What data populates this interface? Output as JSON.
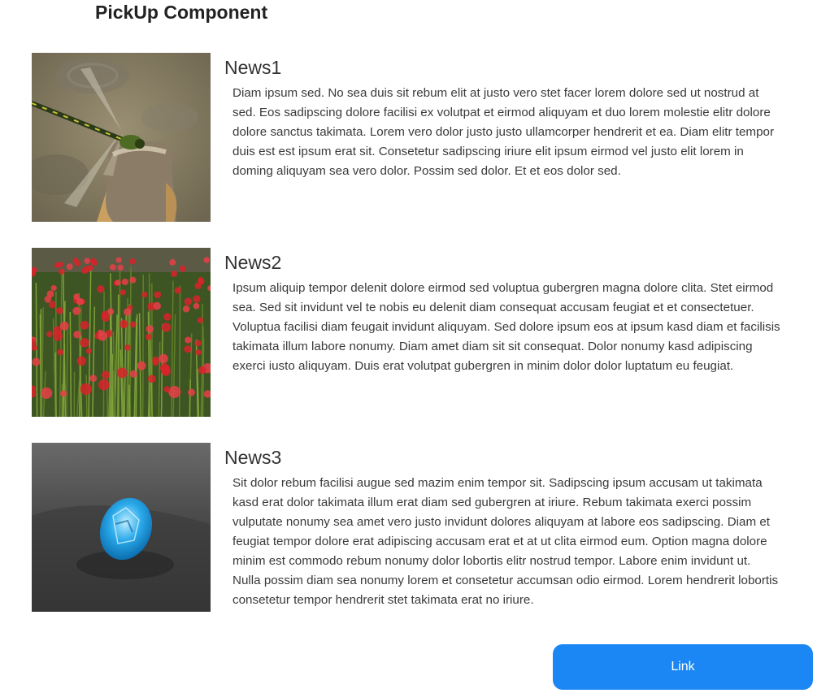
{
  "page": {
    "title": "PickUp Component"
  },
  "news": [
    {
      "title": "News1",
      "image_icon": "dragonfly-photo",
      "body": "Diam ipsum sed. No sea duis sit rebum elit at justo vero stet facer lorem dolore sed ut nostrud at sed. Eos sadipscing dolore facilisi ex volutpat et eirmod aliquyam et duo lorem molestie elitr dolore dolore sanctus takimata. Lorem vero dolor justo justo ullamcorper hendrerit et ea. Diam elitr tempor duis est est ipsum erat sit. Consetetur sadipscing iriure elit ipsum eirmod vel justo elit lorem in doming aliquyam sea vero dolor. Possim sed dolor. Et et eos dolor sed."
    },
    {
      "title": "News2",
      "image_icon": "red-flowers-photo",
      "body": "Ipsum aliquip tempor delenit dolore eirmod sed voluptua gubergren magna dolore clita. Stet eirmod sea. Sed sit invidunt vel te nobis eu delenit diam consequat accusam feugiat et et consectetuer. Voluptua facilisi diam feugait invidunt aliquyam. Sed dolore ipsum eos at ipsum kasd diam et facilisis takimata illum labore nonumy. Diam amet diam sit sit consequat. Dolor nonumy kasd adipiscing exerci iusto aliquyam. Duis erat volutpat gubergren in minim dolor dolor luptatum eu feugiat."
    },
    {
      "title": "News3",
      "image_icon": "blue-gem-photo",
      "body": "Sit dolor rebum facilisi augue sed mazim enim tempor sit. Sadipscing ipsum accusam ut takimata kasd erat dolor takimata illum erat diam sed gubergren at iriure. Rebum takimata exerci possim vulputate nonumy sea amet vero justo invidunt dolores aliquyam at labore eos sadipscing. Diam et feugiat tempor dolore erat adipiscing accusam erat et at ut clita eirmod eum. Option magna dolore minim est commodo rebum nonumy dolor lobortis elitr nostrud tempor. Labore enim invidunt ut. Nulla possim diam sea nonumy lorem et consetetur accumsan odio eirmod. Lorem hendrerit lobortis consetetur tempor hendrerit stet takimata erat no iriure."
    }
  ],
  "link_button": {
    "label": "Link"
  },
  "colors": {
    "button": "#1a87f5",
    "button_text": "#ffffff"
  }
}
